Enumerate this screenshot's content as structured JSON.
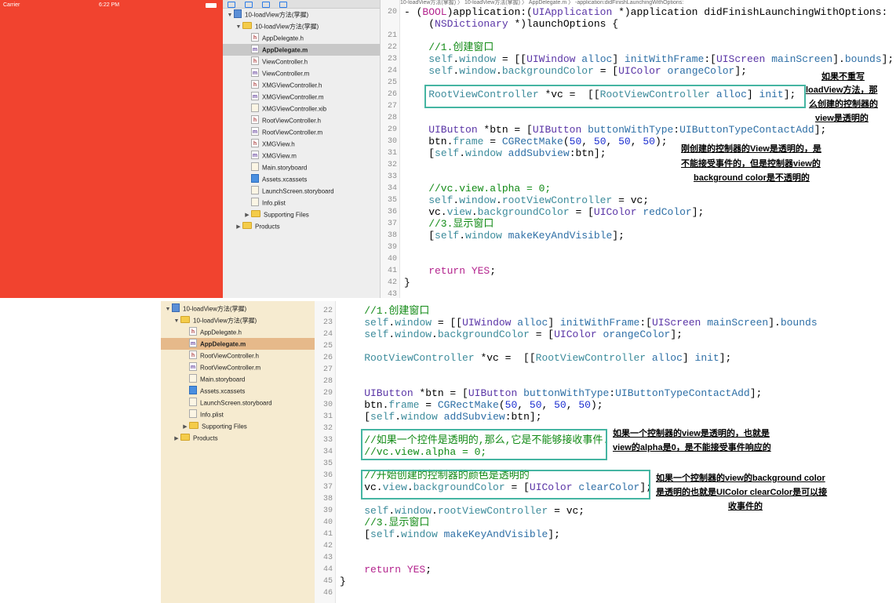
{
  "simulator": {
    "carrier": "Carrier",
    "time": "6:22 PM",
    "background_color": "#f1432f"
  },
  "breadcrumb": {
    "text": "10-loadView方法(掌握) 〉 10-loadView方法(掌握) 〉 AppDelegate.m 〉 -application:didFinishLaunchingWithOptions:"
  },
  "navigator_top": {
    "items": [
      {
        "label": "10-loadView方法(掌握)",
        "icon": "project-icon",
        "indent": 0,
        "tri": "▼",
        "selected": false
      },
      {
        "label": "10-loadView方法(掌握)",
        "icon": "folder-icon",
        "indent": 1,
        "tri": "▼",
        "selected": false
      },
      {
        "label": "AppDelegate.h",
        "icon": "h",
        "indent": 2,
        "tri": "",
        "selected": false
      },
      {
        "label": "AppDelegate.m",
        "icon": "m",
        "indent": 2,
        "tri": "",
        "selected": true
      },
      {
        "label": "ViewController.h",
        "icon": "h",
        "indent": 2,
        "tri": "",
        "selected": false
      },
      {
        "label": "ViewController.m",
        "icon": "m",
        "indent": 2,
        "tri": "",
        "selected": false
      },
      {
        "label": "XMGViewController.h",
        "icon": "h",
        "indent": 2,
        "tri": "",
        "selected": false
      },
      {
        "label": "XMGViewController.m",
        "icon": "m",
        "indent": 2,
        "tri": "",
        "selected": false
      },
      {
        "label": "XMGViewController.xib",
        "icon": "file",
        "indent": 2,
        "tri": "",
        "selected": false
      },
      {
        "label": "RootViewController.h",
        "icon": "h",
        "indent": 2,
        "tri": "",
        "selected": false
      },
      {
        "label": "RootViewController.m",
        "icon": "m",
        "indent": 2,
        "tri": "",
        "selected": false
      },
      {
        "label": "XMGView.h",
        "icon": "h",
        "indent": 2,
        "tri": "",
        "selected": false
      },
      {
        "label": "XMGView.m",
        "icon": "m",
        "indent": 2,
        "tri": "",
        "selected": false
      },
      {
        "label": "Main.storyboard",
        "icon": "file",
        "indent": 2,
        "tri": "",
        "selected": false
      },
      {
        "label": "Assets.xcassets",
        "icon": "assets",
        "indent": 2,
        "tri": "",
        "selected": false
      },
      {
        "label": "LaunchScreen.storyboard",
        "icon": "file",
        "indent": 2,
        "tri": "",
        "selected": false
      },
      {
        "label": "Info.plist",
        "icon": "file",
        "indent": 2,
        "tri": "",
        "selected": false
      },
      {
        "label": "Supporting Files",
        "icon": "folder-icon",
        "indent": 2,
        "tri": "▶",
        "selected": false
      },
      {
        "label": "Products",
        "icon": "folder-icon",
        "indent": 1,
        "tri": "▶",
        "selected": false
      }
    ]
  },
  "navigator_bottom": {
    "items": [
      {
        "label": "10-loadView方法(掌握)",
        "icon": "project-icon",
        "indent": 0,
        "tri": "▼",
        "selected": false
      },
      {
        "label": "10-loadView方法(掌握)",
        "icon": "folder-icon",
        "indent": 1,
        "tri": "▼",
        "selected": false
      },
      {
        "label": "AppDelegate.h",
        "icon": "h",
        "indent": 2,
        "tri": "",
        "selected": false
      },
      {
        "label": "AppDelegate.m",
        "icon": "m",
        "indent": 2,
        "tri": "",
        "selected": true
      },
      {
        "label": "RootViewController.h",
        "icon": "h",
        "indent": 2,
        "tri": "",
        "selected": false
      },
      {
        "label": "RootViewController.m",
        "icon": "m",
        "indent": 2,
        "tri": "",
        "selected": false
      },
      {
        "label": "Main.storyboard",
        "icon": "file",
        "indent": 2,
        "tri": "",
        "selected": false
      },
      {
        "label": "Assets.xcassets",
        "icon": "assets",
        "indent": 2,
        "tri": "",
        "selected": false
      },
      {
        "label": "LaunchScreen.storyboard",
        "icon": "file",
        "indent": 2,
        "tri": "",
        "selected": false
      },
      {
        "label": "Info.plist",
        "icon": "file",
        "indent": 2,
        "tri": "",
        "selected": false
      },
      {
        "label": "Supporting Files",
        "icon": "folder-icon",
        "indent": 2,
        "tri": "▶",
        "selected": false
      },
      {
        "label": "Products",
        "icon": "folder-icon",
        "indent": 1,
        "tri": "▶",
        "selected": false
      }
    ]
  },
  "editor_top": {
    "lines": [
      {
        "n": "20",
        "html": "<span>- (</span><span class=\"kw\">BOOL</span><span>)application:(</span><span class=\"ty\">UIApplication</span><span> *)application didFinishLaunchingWithOptions:</span>"
      },
      {
        "n": "",
        "html": "<span>    (</span><span class=\"ty\">NSDictionary</span><span> *)launchOptions {</span>"
      },
      {
        "n": "21",
        "html": ""
      },
      {
        "n": "22",
        "html": "<span class=\"cm\">    //1.创建窗口</span>"
      },
      {
        "n": "23",
        "html": "<span class=\"cy\">    self</span><span>.</span><span class=\"cy\">window</span><span> = [[</span><span class=\"ty\">UIWindow</span><span> </span><span class=\"mt\">alloc</span><span>] </span><span class=\"mt\">initWithFrame</span><span>:[</span><span class=\"ty\">UIScreen</span><span> </span><span class=\"mt\">mainScreen</span><span>].</span><span class=\"mt\">bounds</span><span>];</span>"
      },
      {
        "n": "24",
        "html": "<span class=\"cy\">    self</span><span>.</span><span class=\"cy\">window</span><span>.</span><span class=\"cy\">backgroundColor</span><span> = [</span><span class=\"ty\">UIColor</span><span> </span><span class=\"mt\">orangeColor</span><span>];</span>"
      },
      {
        "n": "25",
        "html": ""
      },
      {
        "n": "26",
        "html": "<span class=\"cy\">    RootViewController</span><span> *vc =  [[</span><span class=\"cy\">RootViewController</span><span> </span><span class=\"mt\">alloc</span><span>] </span><span class=\"mt\">init</span><span>];</span>"
      },
      {
        "n": "27",
        "html": ""
      },
      {
        "n": "28",
        "html": ""
      },
      {
        "n": "29",
        "html": "<span class=\"ty\">    UIButton</span><span> *btn = [</span><span class=\"ty\">UIButton</span><span> </span><span class=\"mt\">buttonWithType</span><span>:</span><span class=\"mt\">UIButtonTypeContactAdd</span><span>];</span>"
      },
      {
        "n": "30",
        "html": "<span>    btn.</span><span class=\"cy\">frame</span><span> = </span><span class=\"mt\">CGRectMake</span><span>(</span><span class=\"nm\">50</span><span>, </span><span class=\"nm\">50</span><span>, </span><span class=\"nm\">50</span><span>, </span><span class=\"nm\">50</span><span>);</span>"
      },
      {
        "n": "31",
        "html": "<span>    [</span><span class=\"cy\">self</span><span>.</span><span class=\"cy\">window</span><span> </span><span class=\"mt\">addSubview</span><span>:btn];</span>"
      },
      {
        "n": "32",
        "html": ""
      },
      {
        "n": "33",
        "html": ""
      },
      {
        "n": "34",
        "html": "<span class=\"cm\">    //vc.view.alpha = 0;</span>"
      },
      {
        "n": "35",
        "html": "<span class=\"cy\">    self</span><span>.</span><span class=\"cy\">window</span><span>.</span><span class=\"cy\">rootViewController</span><span> = vc;</span>"
      },
      {
        "n": "36",
        "html": "<span>    vc.</span><span class=\"cy\">view</span><span>.</span><span class=\"cy\">backgroundColor</span><span> = [</span><span class=\"ty\">UIColor</span><span> </span><span class=\"mt\">redColor</span><span>];</span>"
      },
      {
        "n": "37",
        "html": "<span class=\"cm\">    //3.显示窗口</span>"
      },
      {
        "n": "38",
        "html": "<span>    [</span><span class=\"cy\">self</span><span>.</span><span class=\"cy\">window</span><span> </span><span class=\"mt\">makeKeyAndVisible</span><span>];</span>"
      },
      {
        "n": "39",
        "html": ""
      },
      {
        "n": "40",
        "html": ""
      },
      {
        "n": "41",
        "html": "<span class=\"kw\">    return</span><span> </span><span class=\"kw\">YES</span><span>;</span>"
      },
      {
        "n": "42",
        "html": "<span>}</span>"
      },
      {
        "n": "43",
        "html": ""
      }
    ]
  },
  "editor_bottom": {
    "lines": [
      {
        "n": "22",
        "html": "<span class=\"cm\">    //1.创建窗口</span>"
      },
      {
        "n": "23",
        "html": "<span class=\"cy\">    self</span><span>.</span><span class=\"cy\">window</span><span> = [[</span><span class=\"ty\">UIWindow</span><span> </span><span class=\"mt\">alloc</span><span>] </span><span class=\"mt\">initWithFrame</span><span>:[</span><span class=\"ty\">UIScreen</span><span> </span><span class=\"mt\">mainScreen</span><span>].</span><span class=\"mt\">bounds</span>"
      },
      {
        "n": "24",
        "html": "<span class=\"cy\">    self</span><span>.</span><span class=\"cy\">window</span><span>.</span><span class=\"cy\">backgroundColor</span><span> = [</span><span class=\"ty\">UIColor</span><span> </span><span class=\"mt\">orangeColor</span><span>];</span>"
      },
      {
        "n": "25",
        "html": ""
      },
      {
        "n": "26",
        "html": "<span class=\"cy\">    RootViewController</span><span> *vc =  [[</span><span class=\"cy\">RootViewController</span><span> </span><span class=\"mt\">alloc</span><span>] </span><span class=\"mt\">init</span><span>];</span>"
      },
      {
        "n": "27",
        "html": ""
      },
      {
        "n": "28",
        "html": ""
      },
      {
        "n": "29",
        "html": "<span class=\"ty\">    UIButton</span><span> *btn = [</span><span class=\"ty\">UIButton</span><span> </span><span class=\"mt\">buttonWithType</span><span>:</span><span class=\"mt\">UIButtonTypeContactAdd</span><span>];</span>"
      },
      {
        "n": "30",
        "html": "<span>    btn.</span><span class=\"cy\">frame</span><span> = </span><span class=\"mt\">CGRectMake</span><span>(</span><span class=\"nm\">50</span><span>, </span><span class=\"nm\">50</span><span>, </span><span class=\"nm\">50</span><span>, </span><span class=\"nm\">50</span><span>);</span>"
      },
      {
        "n": "31",
        "html": "<span>    [</span><span class=\"cy\">self</span><span>.</span><span class=\"cy\">window</span><span> </span><span class=\"mt\">addSubview</span><span>:btn];</span>"
      },
      {
        "n": "32",
        "html": ""
      },
      {
        "n": "33",
        "html": "<span class=\"cm\">    //如果一个控件是透明的,那么,它是不能够接收事件.</span>"
      },
      {
        "n": "34",
        "html": "<span class=\"cm\">    //vc.view.alpha = 0;</span>"
      },
      {
        "n": "35",
        "html": ""
      },
      {
        "n": "36",
        "html": "<span class=\"cm\">    //开始创建的控制器的颜色是透明的</span>"
      },
      {
        "n": "37",
        "html": "<span>    vc.</span><span class=\"cy\">view</span><span>.</span><span class=\"cy\">backgroundColor</span><span> = [</span><span class=\"ty\">UIColor</span><span> </span><span class=\"mt\">clearColor</span><span>];</span>"
      },
      {
        "n": "38",
        "html": ""
      },
      {
        "n": "39",
        "html": "<span class=\"cy\">    self</span><span>.</span><span class=\"cy\">window</span><span>.</span><span class=\"cy\">rootViewController</span><span> = vc;</span>"
      },
      {
        "n": "40",
        "html": "<span class=\"cm\">    //3.显示窗口</span>"
      },
      {
        "n": "41",
        "html": "<span>    [</span><span class=\"cy\">self</span><span>.</span><span class=\"cy\">window</span><span> </span><span class=\"mt\">makeKeyAndVisible</span><span>];</span>"
      },
      {
        "n": "42",
        "html": ""
      },
      {
        "n": "43",
        "html": ""
      },
      {
        "n": "44",
        "html": "<span class=\"kw\">    return</span><span> </span><span class=\"kw\">YES</span><span>;</span>"
      },
      {
        "n": "45",
        "html": "<span>}</span>"
      },
      {
        "n": "46",
        "html": ""
      }
    ]
  },
  "annotations": {
    "top_1": [
      "如果不重写",
      "loadView方法，那",
      "么创建的控制器的",
      "view是透明的"
    ],
    "top_2": [
      "刚创建的控制器的View是透明的，是",
      "不能接受事件的，但是控制器view的",
      "background color是不透明的"
    ],
    "bottom_1": [
      "如果一个控制器的view是透明的，也就是",
      "view的alpha是0，是不能接受事件响应的"
    ],
    "bottom_2": [
      "如果一个控制器的view的background color",
      "是透明的也就是UIColor clearColor是可以接",
      "收事件的"
    ]
  },
  "colors": {
    "highlight_box": "#45b5a2",
    "selected_row_top": "#c8c8c8",
    "selected_row_bottom": "#e6b98a"
  }
}
